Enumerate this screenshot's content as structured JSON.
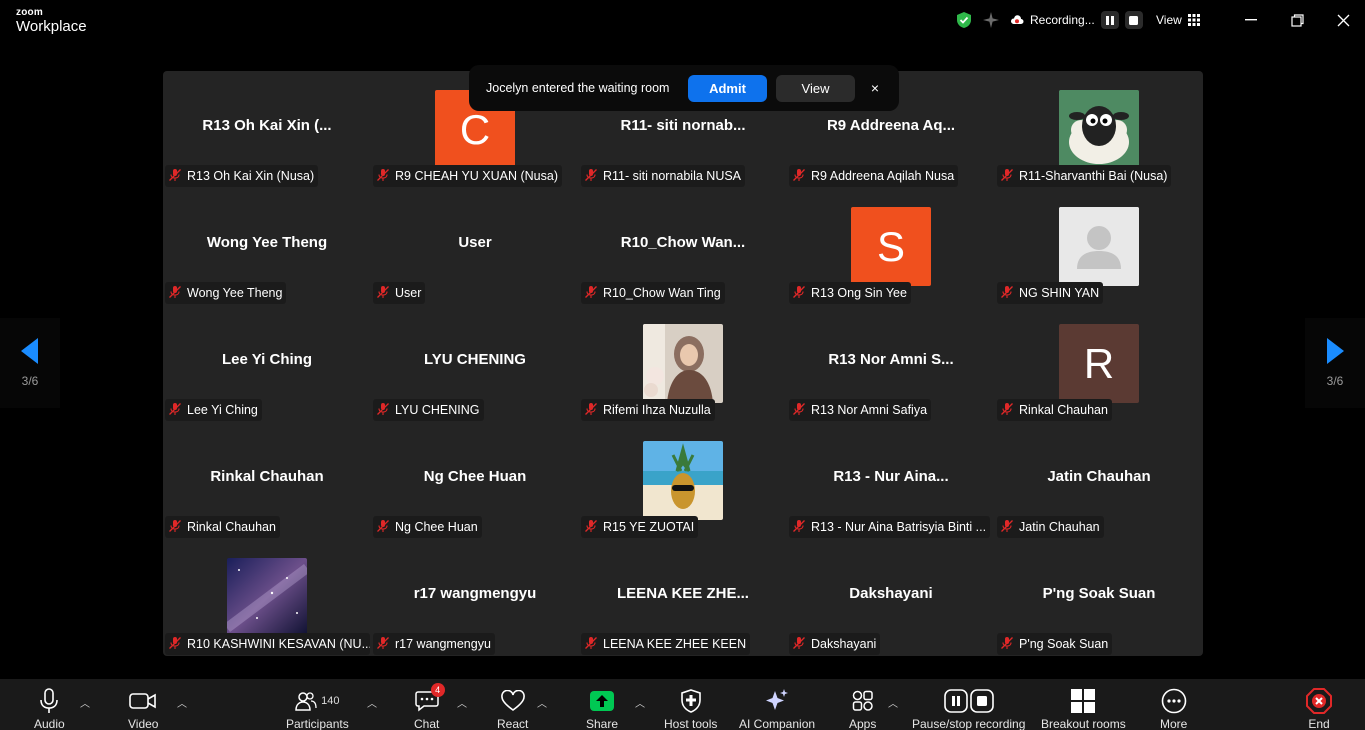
{
  "app": {
    "brand_top": "zoom",
    "brand_bottom": "Workplace"
  },
  "titlebar": {
    "recording_label": "Recording...",
    "view_label": "View"
  },
  "pagination": {
    "left": "3/6",
    "right": "3/6"
  },
  "notification": {
    "message": "Jocelyn entered the waiting room",
    "admit_label": "Admit",
    "view_label": "View",
    "close_label": "×"
  },
  "participants": [
    {
      "display": "R13 Oh Kai Xin (...",
      "tag": "R13 Oh Kai Xin (Nusa)"
    },
    {
      "display": "",
      "avatar_letter": "C",
      "tag": "R9 CHEAH YU XUAN (Nusa)"
    },
    {
      "display": "R11- siti nornab...",
      "tag": "R11- siti nornabila NUSA"
    },
    {
      "display": "R9 Addreena Aq...",
      "tag": "R9 Addreena Aqilah Nusa"
    },
    {
      "display": "",
      "tag": "R11-Sharvanthi Bai (Nusa)"
    },
    {
      "display": "Wong Yee Theng",
      "tag": "Wong Yee Theng"
    },
    {
      "display": "User",
      "tag": "User"
    },
    {
      "display": "R10_Chow  Wan...",
      "tag": "R10_Chow Wan Ting"
    },
    {
      "display": "",
      "avatar_letter": "S",
      "tag": "R13 Ong Sin Yee"
    },
    {
      "display": "",
      "tag": "NG SHIN YAN"
    },
    {
      "display": "Lee Yi Ching",
      "tag": "Lee Yi Ching"
    },
    {
      "display": "LYU CHENING",
      "tag": "LYU CHENING"
    },
    {
      "display": "",
      "tag": "Rifemi Ihza Nuzulla"
    },
    {
      "display": "R13  Nor Amni S...",
      "tag": "R13 Nor Amni Safiya"
    },
    {
      "display": "",
      "avatar_letter": "R",
      "tag": "Rinkal Chauhan"
    },
    {
      "display": "Rinkal Chauhan",
      "tag": "Rinkal Chauhan"
    },
    {
      "display": "Ng Chee Huan",
      "tag": "Ng Chee Huan"
    },
    {
      "display": "",
      "tag": "R15 YE ZUOTAI"
    },
    {
      "display": "R13 - Nur Aina...",
      "tag": "R13 - Nur Aina Batrisyia Binti ..."
    },
    {
      "display": "Jatin Chauhan",
      "tag": "Jatin Chauhan"
    },
    {
      "display": "",
      "tag": "R10 KASHWINI KESAVAN (NU..."
    },
    {
      "display": "r17 wangmengyu",
      "tag": "r17 wangmengyu"
    },
    {
      "display": "LEENA  KEE ZHE...",
      "tag": "LEENA KEE ZHEE KEEN"
    },
    {
      "display": "Dakshayani",
      "tag": "Dakshayani"
    },
    {
      "display": "P'ng Soak Suan",
      "tag": "P'ng Soak Suan"
    }
  ],
  "toolbar": {
    "audio": "Audio",
    "video": "Video",
    "participants": "Participants",
    "participants_count": "140",
    "chat": "Chat",
    "chat_badge": "4",
    "react": "React",
    "share": "Share",
    "host_tools": "Host tools",
    "ai_companion": "AI Companion",
    "apps": "Apps",
    "pause_stop_recording": "Pause/stop recording",
    "breakout_rooms": "Breakout rooms",
    "more": "More",
    "end": "End"
  },
  "colors": {
    "accent": "#0e72ed",
    "share": "#00c853",
    "avatar_orange": "#f0501e",
    "avatar_brown": "#5b3a33",
    "end_red": "#e02828"
  }
}
